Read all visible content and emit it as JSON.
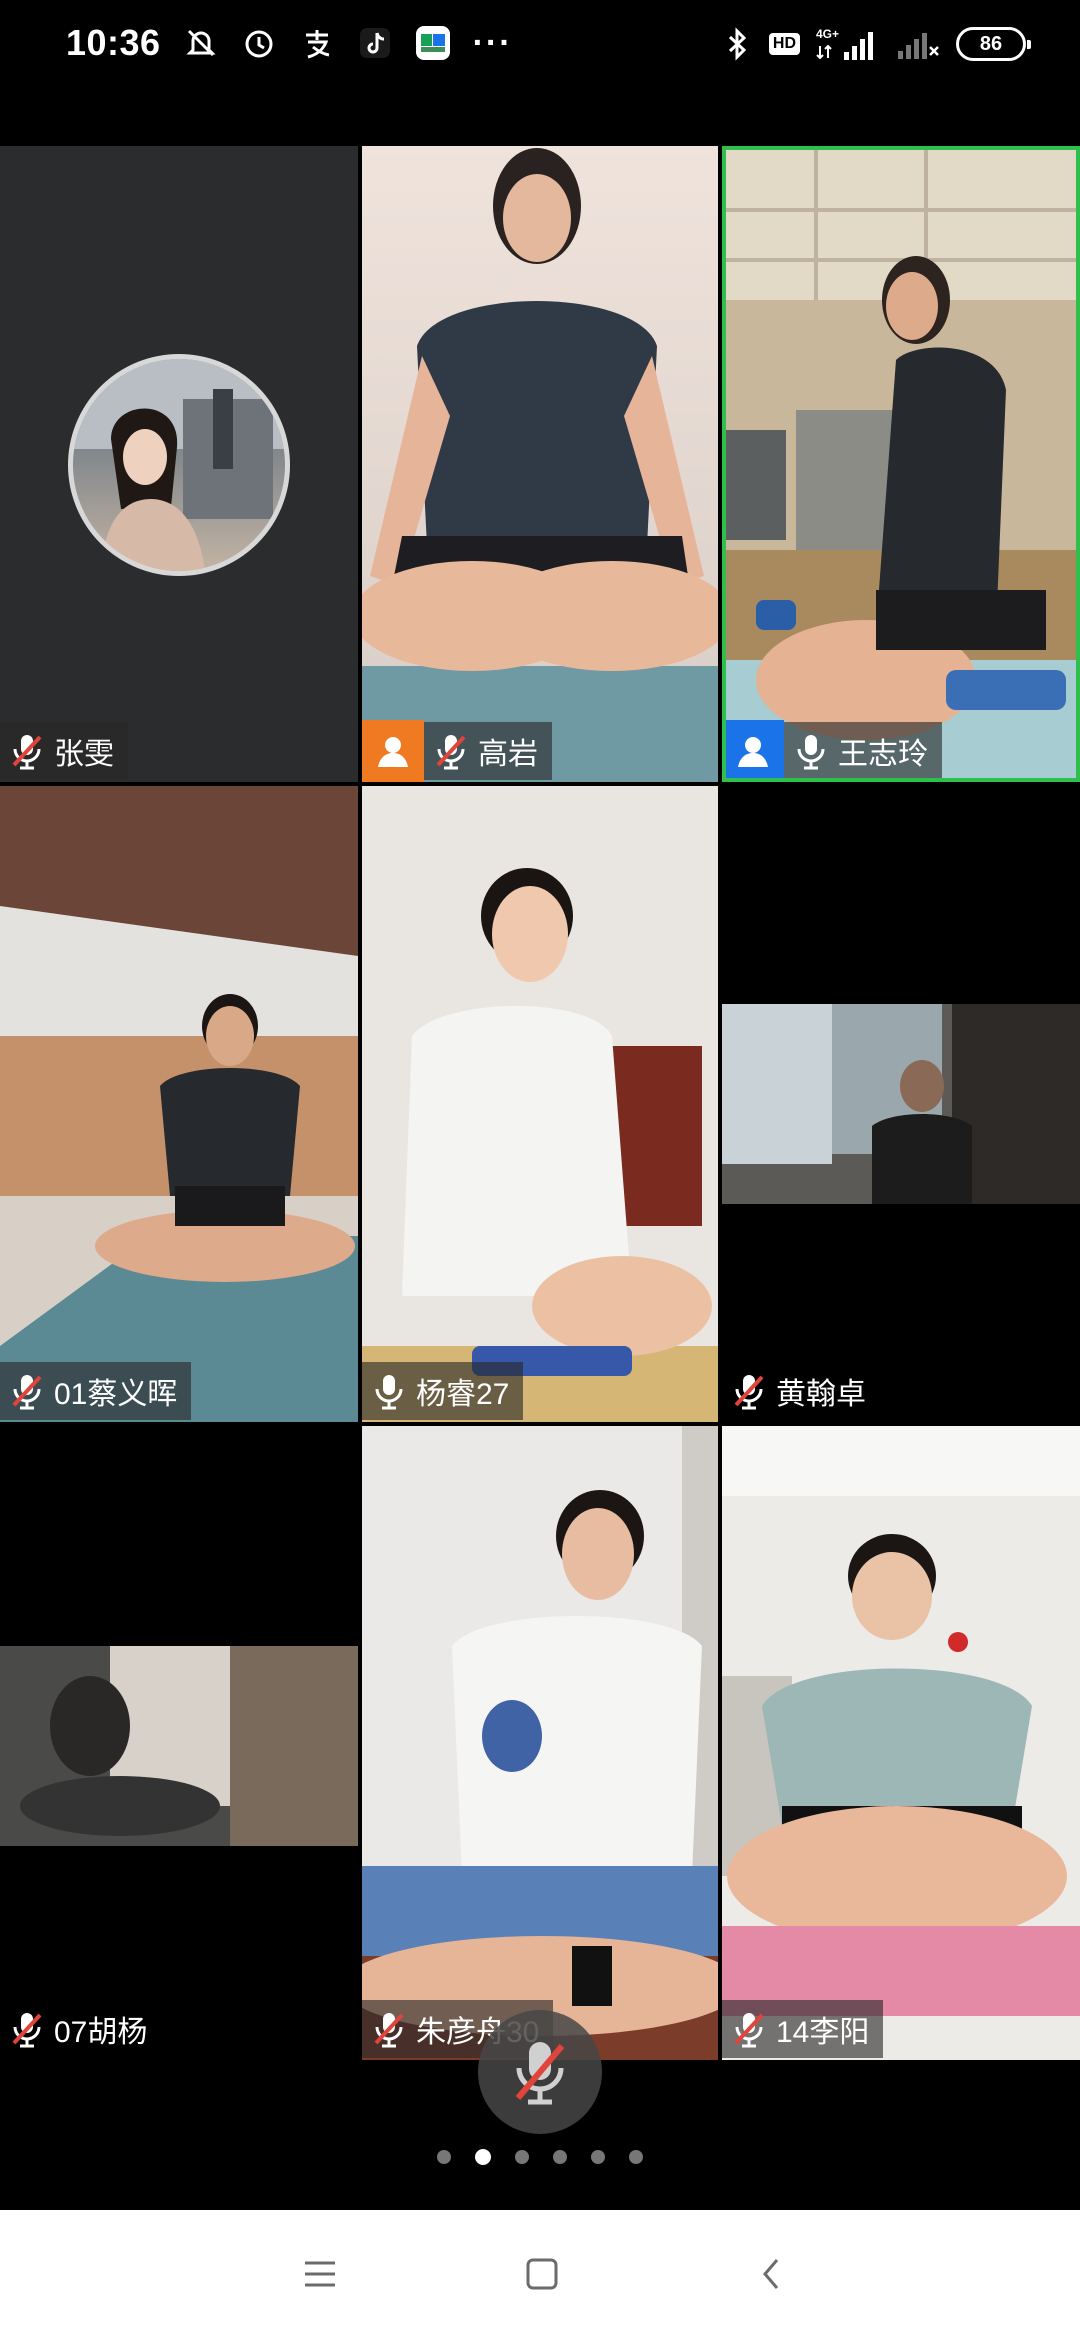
{
  "status_bar": {
    "time": "10:36",
    "battery": "86",
    "network_label": "4G+",
    "hd_label": "HD",
    "more": "···",
    "left_icons": [
      "mute-bell-icon",
      "alarm-icon",
      "alipay-icon",
      "tiktok-icon",
      "chat-app-icon"
    ],
    "right_icons": [
      "bluetooth-icon",
      "hd-icon",
      "signal-4g-icon",
      "signal-no-sim-icon",
      "battery-icon"
    ]
  },
  "participants": [
    {
      "name": "张雯",
      "mic": "muted",
      "role": "none",
      "video": "avatar"
    },
    {
      "name": "高岩",
      "mic": "muted",
      "role": "host",
      "video": "camera"
    },
    {
      "name": "王志玲",
      "mic": "on",
      "role": "cohost",
      "video": "camera",
      "speaking": true
    },
    {
      "name": "01蔡义晖",
      "mic": "muted",
      "role": "none",
      "video": "camera"
    },
    {
      "name": "杨睿27",
      "mic": "on",
      "role": "none",
      "video": "camera"
    },
    {
      "name": "黄翰卓",
      "mic": "muted",
      "role": "none",
      "video": "camera"
    },
    {
      "name": "07胡杨",
      "mic": "muted",
      "role": "none",
      "video": "camera"
    },
    {
      "name": "朱彦舟30",
      "mic": "muted",
      "role": "none",
      "video": "camera"
    },
    {
      "name": "14李阳",
      "mic": "muted",
      "role": "none",
      "video": "camera"
    }
  ],
  "controls": {
    "mute_button_state": "muted",
    "pages_total": 6,
    "current_page": 2
  },
  "nav": {
    "icons": [
      "menu-icon",
      "home-square-icon",
      "back-chevron-icon"
    ]
  },
  "colors": {
    "speaking_border": "#2fbf4b",
    "host_badge": "#f07a22",
    "cohost_badge": "#1a73e8",
    "muted_mic": "#e0443a"
  }
}
